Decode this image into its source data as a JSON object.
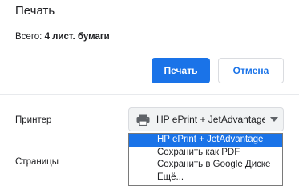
{
  "dialog": {
    "title": "Печать",
    "summary_label": "Всего:",
    "summary_value": "4 лист. бумаги"
  },
  "buttons": {
    "print_label": "Печать",
    "cancel_label": "Отмена"
  },
  "settings": {
    "printer_label": "Принтер",
    "pages_label": "Страницы",
    "printer_selected": "HP ePrint + JetAdvantage",
    "printer_icon": "printer-icon",
    "dropdown_icon": "chevron-down-icon"
  },
  "dropdown": {
    "options": [
      "HP ePrint + JetAdvantage",
      "Сохранить как PDF",
      "Сохранить в Google Диске",
      "Ещё..."
    ],
    "selected_index": 0
  },
  "colors": {
    "accent": "#1a73e8",
    "select_background": "#f1f3f4"
  }
}
